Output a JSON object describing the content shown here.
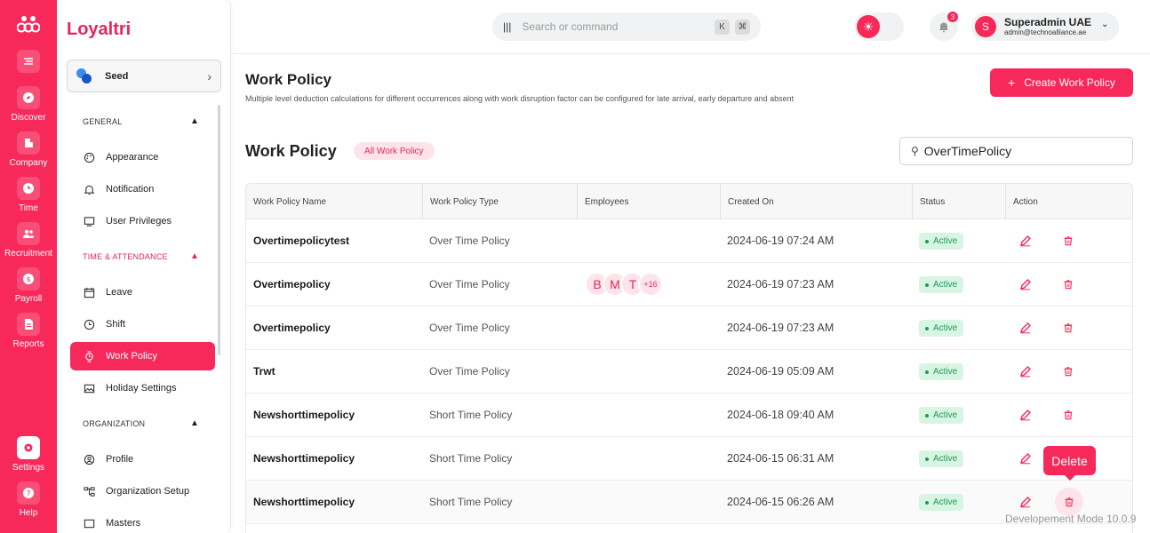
{
  "rail": {
    "items": [
      {
        "label": "",
        "icon": "logo-icon"
      },
      {
        "label": "",
        "icon": "menu-lines-icon"
      },
      {
        "label": "Discover",
        "icon": "compass-icon"
      },
      {
        "label": "Company",
        "icon": "building-icon"
      },
      {
        "label": "Time",
        "icon": "clock-icon"
      },
      {
        "label": "Recruitment",
        "icon": "people-icon"
      },
      {
        "label": "Payroll",
        "icon": "dollar-icon"
      },
      {
        "label": "Reports",
        "icon": "report-icon"
      },
      {
        "label": "Settings",
        "icon": "gear-icon"
      },
      {
        "label": "Help",
        "icon": "help-icon"
      }
    ]
  },
  "sidebar": {
    "brand": "Loyaltri",
    "org_name": "Seed",
    "sections": {
      "general": "GENERAL",
      "time_attendance": "TIME & ATTENDANCE",
      "organization": "ORGANIZATION"
    },
    "items": {
      "appearance": "Appearance",
      "notification": "Notification",
      "user_privileges": "User Privileges",
      "leave": "Leave",
      "shift": "Shift",
      "work_policy": "Work Policy",
      "holiday_settings": "Holiday Settings",
      "profile": "Profile",
      "organization_setup": "Organization Setup",
      "masters": "Masters"
    }
  },
  "topbar": {
    "search_placeholder": "Search or command",
    "kbd_k": "K",
    "kbd_cmd": "⌘",
    "notification_count": "3",
    "user_initial": "S",
    "user_name": "Superadmin UAE",
    "user_email": "admin@technoalliance.ae"
  },
  "main": {
    "title": "Work Policy",
    "description": "Multiple level deduction calculations for different occurrences along with work disruption factor can be configured for late arrival, early departure and absent",
    "create_button": "Create Work Policy",
    "table_title": "Work Policy",
    "filter_chip": "All Work Policy",
    "search_value": "OverTimePolicy",
    "columns": [
      "Work Policy Name",
      "Work Policy Type",
      "Employees",
      "Created On",
      "Status",
      "Action"
    ],
    "rows": [
      {
        "name": "Overtimepolicytest",
        "type": "Over Time Policy",
        "employees": [],
        "more": "",
        "created": "2024-06-19 07:24 AM",
        "status": "Active"
      },
      {
        "name": "Overtimepolicy",
        "type": "Over Time Policy",
        "employees": [
          "B",
          "M",
          "T"
        ],
        "more": "+16",
        "created": "2024-06-19 07:23 AM",
        "status": "Active"
      },
      {
        "name": "Overtimepolicy",
        "type": "Over Time Policy",
        "employees": [],
        "more": "",
        "created": "2024-06-19 07:23 AM",
        "status": "Active"
      },
      {
        "name": "Trwt",
        "type": "Over Time Policy",
        "employees": [],
        "more": "",
        "created": "2024-06-19 05:09 AM",
        "status": "Active"
      },
      {
        "name": "Newshorttimepolicy",
        "type": "Short Time Policy",
        "employees": [],
        "more": "",
        "created": "2024-06-18 09:40 AM",
        "status": "Active"
      },
      {
        "name": "Newshorttimepolicy",
        "type": "Short Time Policy",
        "employees": [],
        "more": "",
        "created": "2024-06-15 06:31 AM",
        "status": "Active"
      },
      {
        "name": "Newshorttimepolicy",
        "type": "Short Time Policy",
        "employees": [],
        "more": "",
        "created": "2024-06-15 06:26 AM",
        "status": "Active"
      }
    ],
    "tooltip": "Delete",
    "dev_mode": "Developement Mode 10.0.9"
  },
  "colors": {
    "accent": "#f7285a",
    "active_badge_bg": "#d8f5e3",
    "active_badge_text": "#1e9a55"
  }
}
